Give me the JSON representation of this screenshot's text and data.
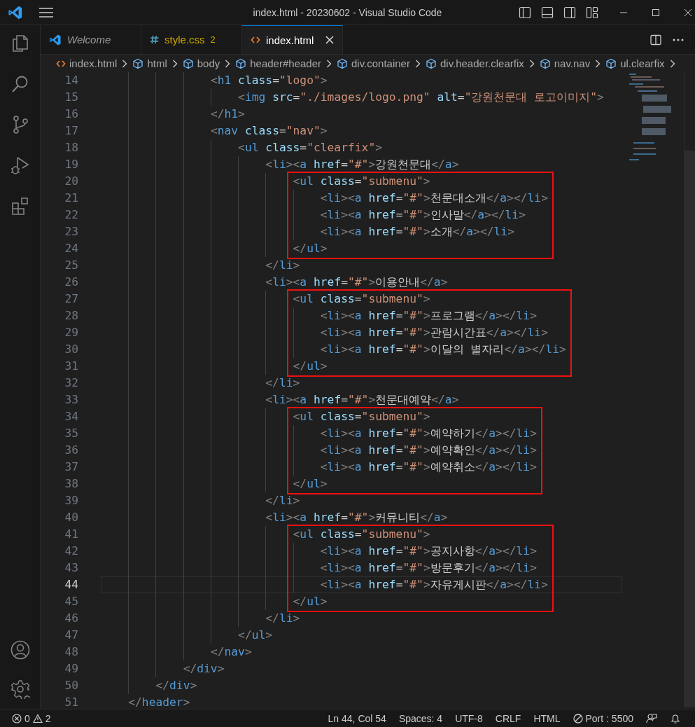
{
  "window": {
    "title": "index.html - 20230602 - Visual Studio Code"
  },
  "activity_bar": [
    {
      "kind": "explorer"
    },
    {
      "kind": "search"
    },
    {
      "kind": "source-control"
    },
    {
      "kind": "run-debug"
    },
    {
      "kind": "extensions"
    }
  ],
  "activity_bar_bottom": [
    {
      "kind": "account"
    },
    {
      "kind": "settings"
    }
  ],
  "tabs": [
    {
      "label": "Welcome",
      "kind": "welcome",
      "selected": false,
      "preview": true
    },
    {
      "label": "style.css",
      "kind": "css",
      "selected": false,
      "preview": false,
      "problems": "2"
    },
    {
      "label": "index.html",
      "kind": "html",
      "selected": true,
      "preview": false
    }
  ],
  "breadcrumbs": [
    {
      "label": "index.html",
      "kind": "file"
    },
    {
      "label": "html",
      "kind": "element"
    },
    {
      "label": "body",
      "kind": "element"
    },
    {
      "label": "header#header",
      "kind": "element"
    },
    {
      "label": "div.container",
      "kind": "element"
    },
    {
      "label": "div.header.clearfix",
      "kind": "element"
    },
    {
      "label": "nav.nav",
      "kind": "element"
    },
    {
      "label": "ul.clearfix",
      "kind": "element"
    }
  ],
  "lines": [
    {
      "number": "14",
      "code": "                <h1 class=\"logo\">",
      "boxed": false,
      "current": false
    },
    {
      "number": "15",
      "code": "                    <img src=\"./images/logo.png\" alt=\"강원천문대 로고이미지\">",
      "boxed": false,
      "current": false
    },
    {
      "number": "16",
      "code": "                </h1>",
      "boxed": false,
      "current": false
    },
    {
      "number": "17",
      "code": "                <nav class=\"nav\">",
      "boxed": false,
      "current": false
    },
    {
      "number": "18",
      "code": "                    <ul class=\"clearfix\">",
      "boxed": false,
      "current": false
    },
    {
      "number": "19",
      "code": "                        <li><a href=\"#\">강원천문대</a>",
      "boxed": false,
      "current": false
    },
    {
      "number": "20",
      "code": "                            <ul class=\"submenu\">",
      "boxed": true,
      "current": false
    },
    {
      "number": "21",
      "code": "                                <li><a href=\"#\">천문대소개</a></li>",
      "boxed": true,
      "current": false
    },
    {
      "number": "22",
      "code": "                                <li><a href=\"#\">인사말</a></li>",
      "boxed": true,
      "current": false
    },
    {
      "number": "23",
      "code": "                                <li><a href=\"#\">소개</a></li>",
      "boxed": true,
      "current": false
    },
    {
      "number": "24",
      "code": "                            </ul>",
      "boxed": true,
      "current": false
    },
    {
      "number": "25",
      "code": "                        </li>",
      "boxed": false,
      "current": false
    },
    {
      "number": "26",
      "code": "                        <li><a href=\"#\">이용안내</a>",
      "boxed": false,
      "current": false
    },
    {
      "number": "27",
      "code": "                            <ul class=\"submenu\">",
      "boxed": true,
      "current": false
    },
    {
      "number": "28",
      "code": "                                <li><a href=\"#\">프로그램</a></li>",
      "boxed": true,
      "current": false
    },
    {
      "number": "29",
      "code": "                                <li><a href=\"#\">관람시간표</a></li>",
      "boxed": true,
      "current": false
    },
    {
      "number": "30",
      "code": "                                <li><a href=\"#\">이달의 별자리</a></li>",
      "boxed": true,
      "current": false
    },
    {
      "number": "31",
      "code": "                            </ul>",
      "boxed": true,
      "current": false
    },
    {
      "number": "32",
      "code": "                        </li>",
      "boxed": false,
      "current": false
    },
    {
      "number": "33",
      "code": "                        <li><a href=\"#\">천문대예약</a>",
      "boxed": false,
      "current": false
    },
    {
      "number": "34",
      "code": "                            <ul class=\"submenu\">",
      "boxed": true,
      "current": false
    },
    {
      "number": "35",
      "code": "                                <li><a href=\"#\">예약하기</a></li>",
      "boxed": true,
      "current": false
    },
    {
      "number": "36",
      "code": "                                <li><a href=\"#\">예약확인</a></li>",
      "boxed": true,
      "current": false
    },
    {
      "number": "37",
      "code": "                                <li><a href=\"#\">예약취소</a></li>",
      "boxed": true,
      "current": false
    },
    {
      "number": "38",
      "code": "                            </ul>",
      "boxed": true,
      "current": false
    },
    {
      "number": "39",
      "code": "                        </li>",
      "boxed": false,
      "current": false
    },
    {
      "number": "40",
      "code": "                        <li><a href=\"#\">커뮤니티</a>",
      "boxed": false,
      "current": false
    },
    {
      "number": "41",
      "code": "                            <ul class=\"submenu\">",
      "boxed": true,
      "current": false
    },
    {
      "number": "42",
      "code": "                                <li><a href=\"#\">공지사항</a></li>",
      "boxed": true,
      "current": false
    },
    {
      "number": "43",
      "code": "                                <li><a href=\"#\">방문후기</a></li>",
      "boxed": true,
      "current": false
    },
    {
      "number": "44",
      "code": "                                <li><a href=\"#\">자유게시판</a></li>",
      "boxed": true,
      "current": true
    },
    {
      "number": "45",
      "code": "                            </ul>",
      "boxed": true,
      "current": false
    },
    {
      "number": "46",
      "code": "                        </li>",
      "boxed": false,
      "current": false
    },
    {
      "number": "47",
      "code": "                    </ul>",
      "boxed": false,
      "current": false
    },
    {
      "number": "48",
      "code": "                </nav>",
      "boxed": false,
      "current": false
    },
    {
      "number": "49",
      "code": "            </div>",
      "boxed": false,
      "current": false
    },
    {
      "number": "50",
      "code": "        </div>",
      "boxed": false,
      "current": false
    },
    {
      "number": "51",
      "code": "    </header>",
      "boxed": false,
      "current": false
    }
  ],
  "status_bar": {
    "errors": "0",
    "warnings": "2",
    "items": [
      {
        "label": "Ln 44, Col 54",
        "kind": "text"
      },
      {
        "label": "Spaces: 4",
        "kind": "text"
      },
      {
        "label": "UTF-8",
        "kind": "text"
      },
      {
        "label": "CRLF",
        "kind": "text"
      },
      {
        "label": "HTML",
        "kind": "text"
      },
      {
        "label": "Port : 5500",
        "kind": "port"
      }
    ]
  }
}
